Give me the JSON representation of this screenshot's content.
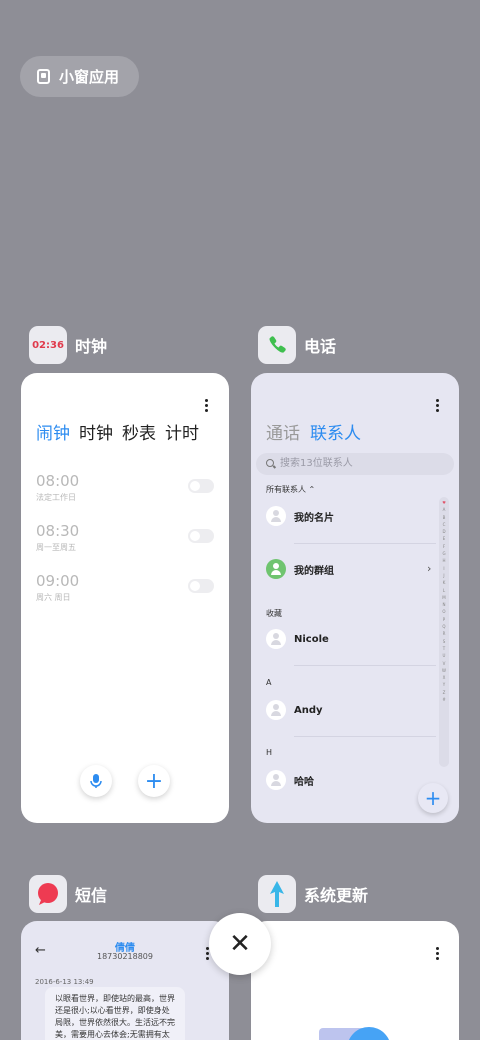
{
  "small_window_button": {
    "label": "小窗应用"
  },
  "cards": {
    "clock": {
      "title": "时钟",
      "icon_time": "02:36",
      "tabs": [
        "闹钟",
        "时钟",
        "秒表",
        "计时"
      ],
      "alarms": [
        {
          "time": "08:00",
          "repeat": "法定工作日",
          "enabled": false
        },
        {
          "time": "08:30",
          "repeat": "周一至周五",
          "enabled": false
        },
        {
          "time": "09:00",
          "repeat": "周六 周日",
          "enabled": false
        }
      ],
      "voice_icon": "microphone-icon",
      "add_label": "+"
    },
    "phone": {
      "title": "电话",
      "tabs": [
        "通话",
        "联系人"
      ],
      "search_placeholder": "搜索13位联系人",
      "all_contacts": "所有联系人",
      "my_card": "我的名片",
      "my_groups": "我的群组",
      "section_fav": "收藏",
      "fav_contact": "Nicole",
      "section_a": "A",
      "contact_a": "Andy",
      "section_h": "H",
      "contact_h": "哈哈",
      "index": [
        "♥",
        "A",
        "B",
        "C",
        "D",
        "E",
        "F",
        "G",
        "H",
        "I",
        "J",
        "K",
        "L",
        "M",
        "N",
        "O",
        "P",
        "Q",
        "R",
        "S",
        "T",
        "U",
        "V",
        "W",
        "X",
        "Y",
        "Z",
        "#"
      ],
      "add_label": "+"
    },
    "sms": {
      "title": "短信",
      "contact": "倩倩",
      "number": "18730218809",
      "date": "2016-6-13 13:49",
      "message": "以眼看世界，即使站的最高，世界还是很小;以心看世界，即使身处局限，世界依然很大。生活远不完美，需要用心去体会;无需拥有太"
    },
    "update": {
      "title": "系统更新"
    }
  },
  "close_button": {
    "icon": "close-icon",
    "label": "✕"
  },
  "colors": {
    "accent": "#2d8cf0",
    "background": "#8e8e96"
  }
}
